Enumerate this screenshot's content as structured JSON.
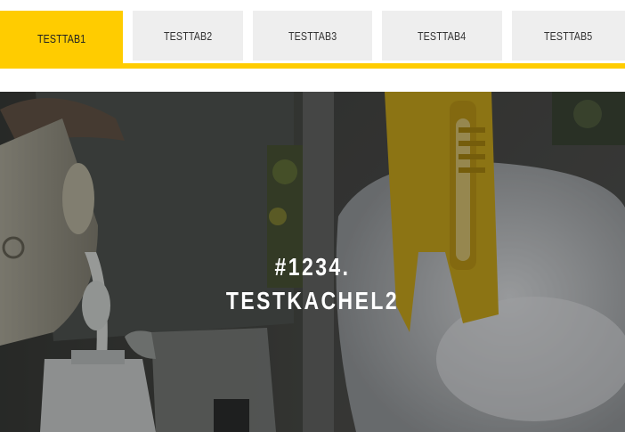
{
  "tabs": [
    {
      "label": "TESTTAB1",
      "active": true
    },
    {
      "label": "TESTTAB2",
      "active": false
    },
    {
      "label": "TESTTAB3",
      "active": false
    },
    {
      "label": "TESTTAB4",
      "active": false
    },
    {
      "label": "TESTTAB5",
      "active": false
    }
  ],
  "colors": {
    "accent": "#ffcc00",
    "tab_inactive": "#eeeeee"
  },
  "hero": {
    "line1": "#1234.",
    "line2": "TESTKACHEL2"
  }
}
